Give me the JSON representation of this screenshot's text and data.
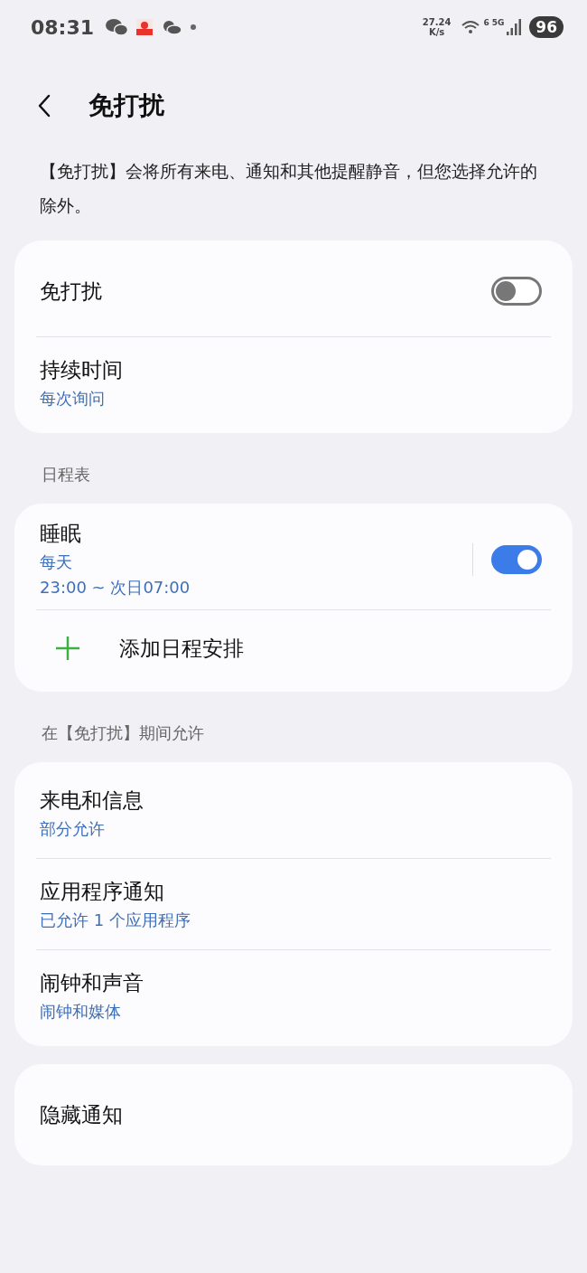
{
  "status_bar": {
    "time": "08:31",
    "speed_value": "27.24",
    "speed_unit": "K/s",
    "wifi_label": "6",
    "network": "5G",
    "battery": "96"
  },
  "header": {
    "title": "免打扰"
  },
  "description": "【免打扰】会将所有来电、通知和其他提醒静音，但您选择允许的除外。",
  "sections": [
    {
      "rows": [
        {
          "kind": "switch",
          "title": "免打扰",
          "on": false
        },
        {
          "kind": "link",
          "title": "持续时间",
          "summary": "每次询问"
        }
      ]
    },
    {
      "heading": "日程表",
      "rows": [
        {
          "kind": "schedule",
          "title": "睡眠",
          "summary": "每天",
          "detail": "23:00 ~ 次日07:00",
          "on": true
        },
        {
          "kind": "add",
          "title": "添加日程安排"
        }
      ]
    },
    {
      "heading": "在【免打扰】期间允许",
      "rows": [
        {
          "kind": "link",
          "title": "来电和信息",
          "summary": "部分允许"
        },
        {
          "kind": "link",
          "title": "应用程序通知",
          "summary": "已允许 1 个应用程序"
        },
        {
          "kind": "link",
          "title": "闹钟和声音",
          "summary": "闹钟和媒体"
        }
      ]
    },
    {
      "rows": [
        {
          "kind": "link",
          "title": "隐藏通知"
        }
      ]
    }
  ]
}
